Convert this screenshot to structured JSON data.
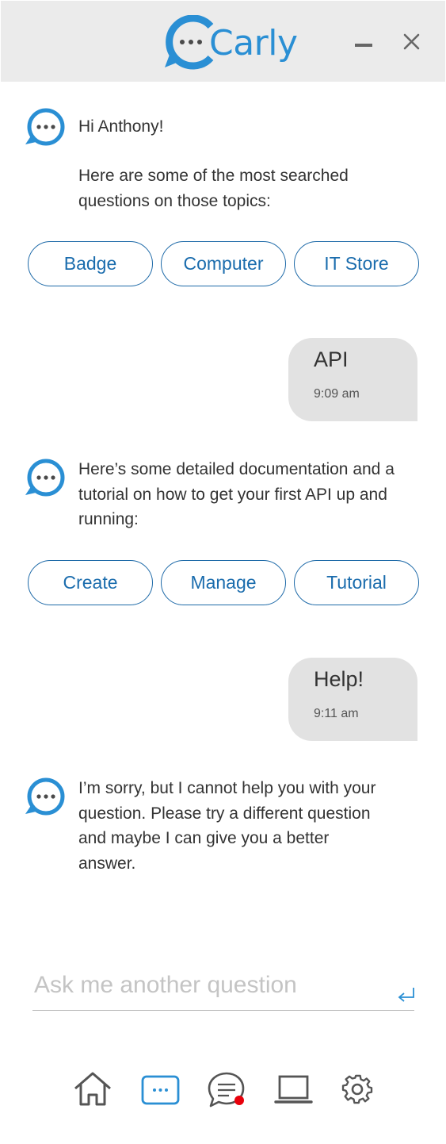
{
  "header": {
    "app_name": "Carly",
    "minimize_icon": "minimize-icon",
    "close_icon": "close-icon"
  },
  "conversation": {
    "greeting": "Hi Anthony!",
    "intro": "Here are some of the most searched questions on those topics:",
    "topic_chips": [
      "Badge",
      "Computer",
      "IT Store"
    ],
    "user_message_1": {
      "text": "API",
      "time": "9:09 am"
    },
    "bot_reply_1": "Here’s some detailed documentation and a tutorial on how to get your first API up and running:",
    "api_chips": [
      "Create",
      "Manage",
      "Tutorial"
    ],
    "user_message_2": {
      "text": "Help!",
      "time": "9:11 am"
    },
    "bot_reply_2": "I’m sorry, but I cannot help you with your question. Please try a different question and maybe I can give you a better answer."
  },
  "composer": {
    "placeholder": "Ask me another question",
    "value": "",
    "send_icon": "enter-icon"
  },
  "bottom_nav": {
    "items": [
      "home-icon",
      "chat-icon",
      "messages-icon",
      "laptop-icon",
      "settings-icon"
    ],
    "active": "chat-icon",
    "notification_color": "#e8000b"
  },
  "colors": {
    "brand": "#2a8fd4",
    "chip_border": "#1e6aa8",
    "chip_text": "#1a6cad",
    "user_bubble": "#e2e2e2",
    "header_bg": "#ebebeb"
  }
}
